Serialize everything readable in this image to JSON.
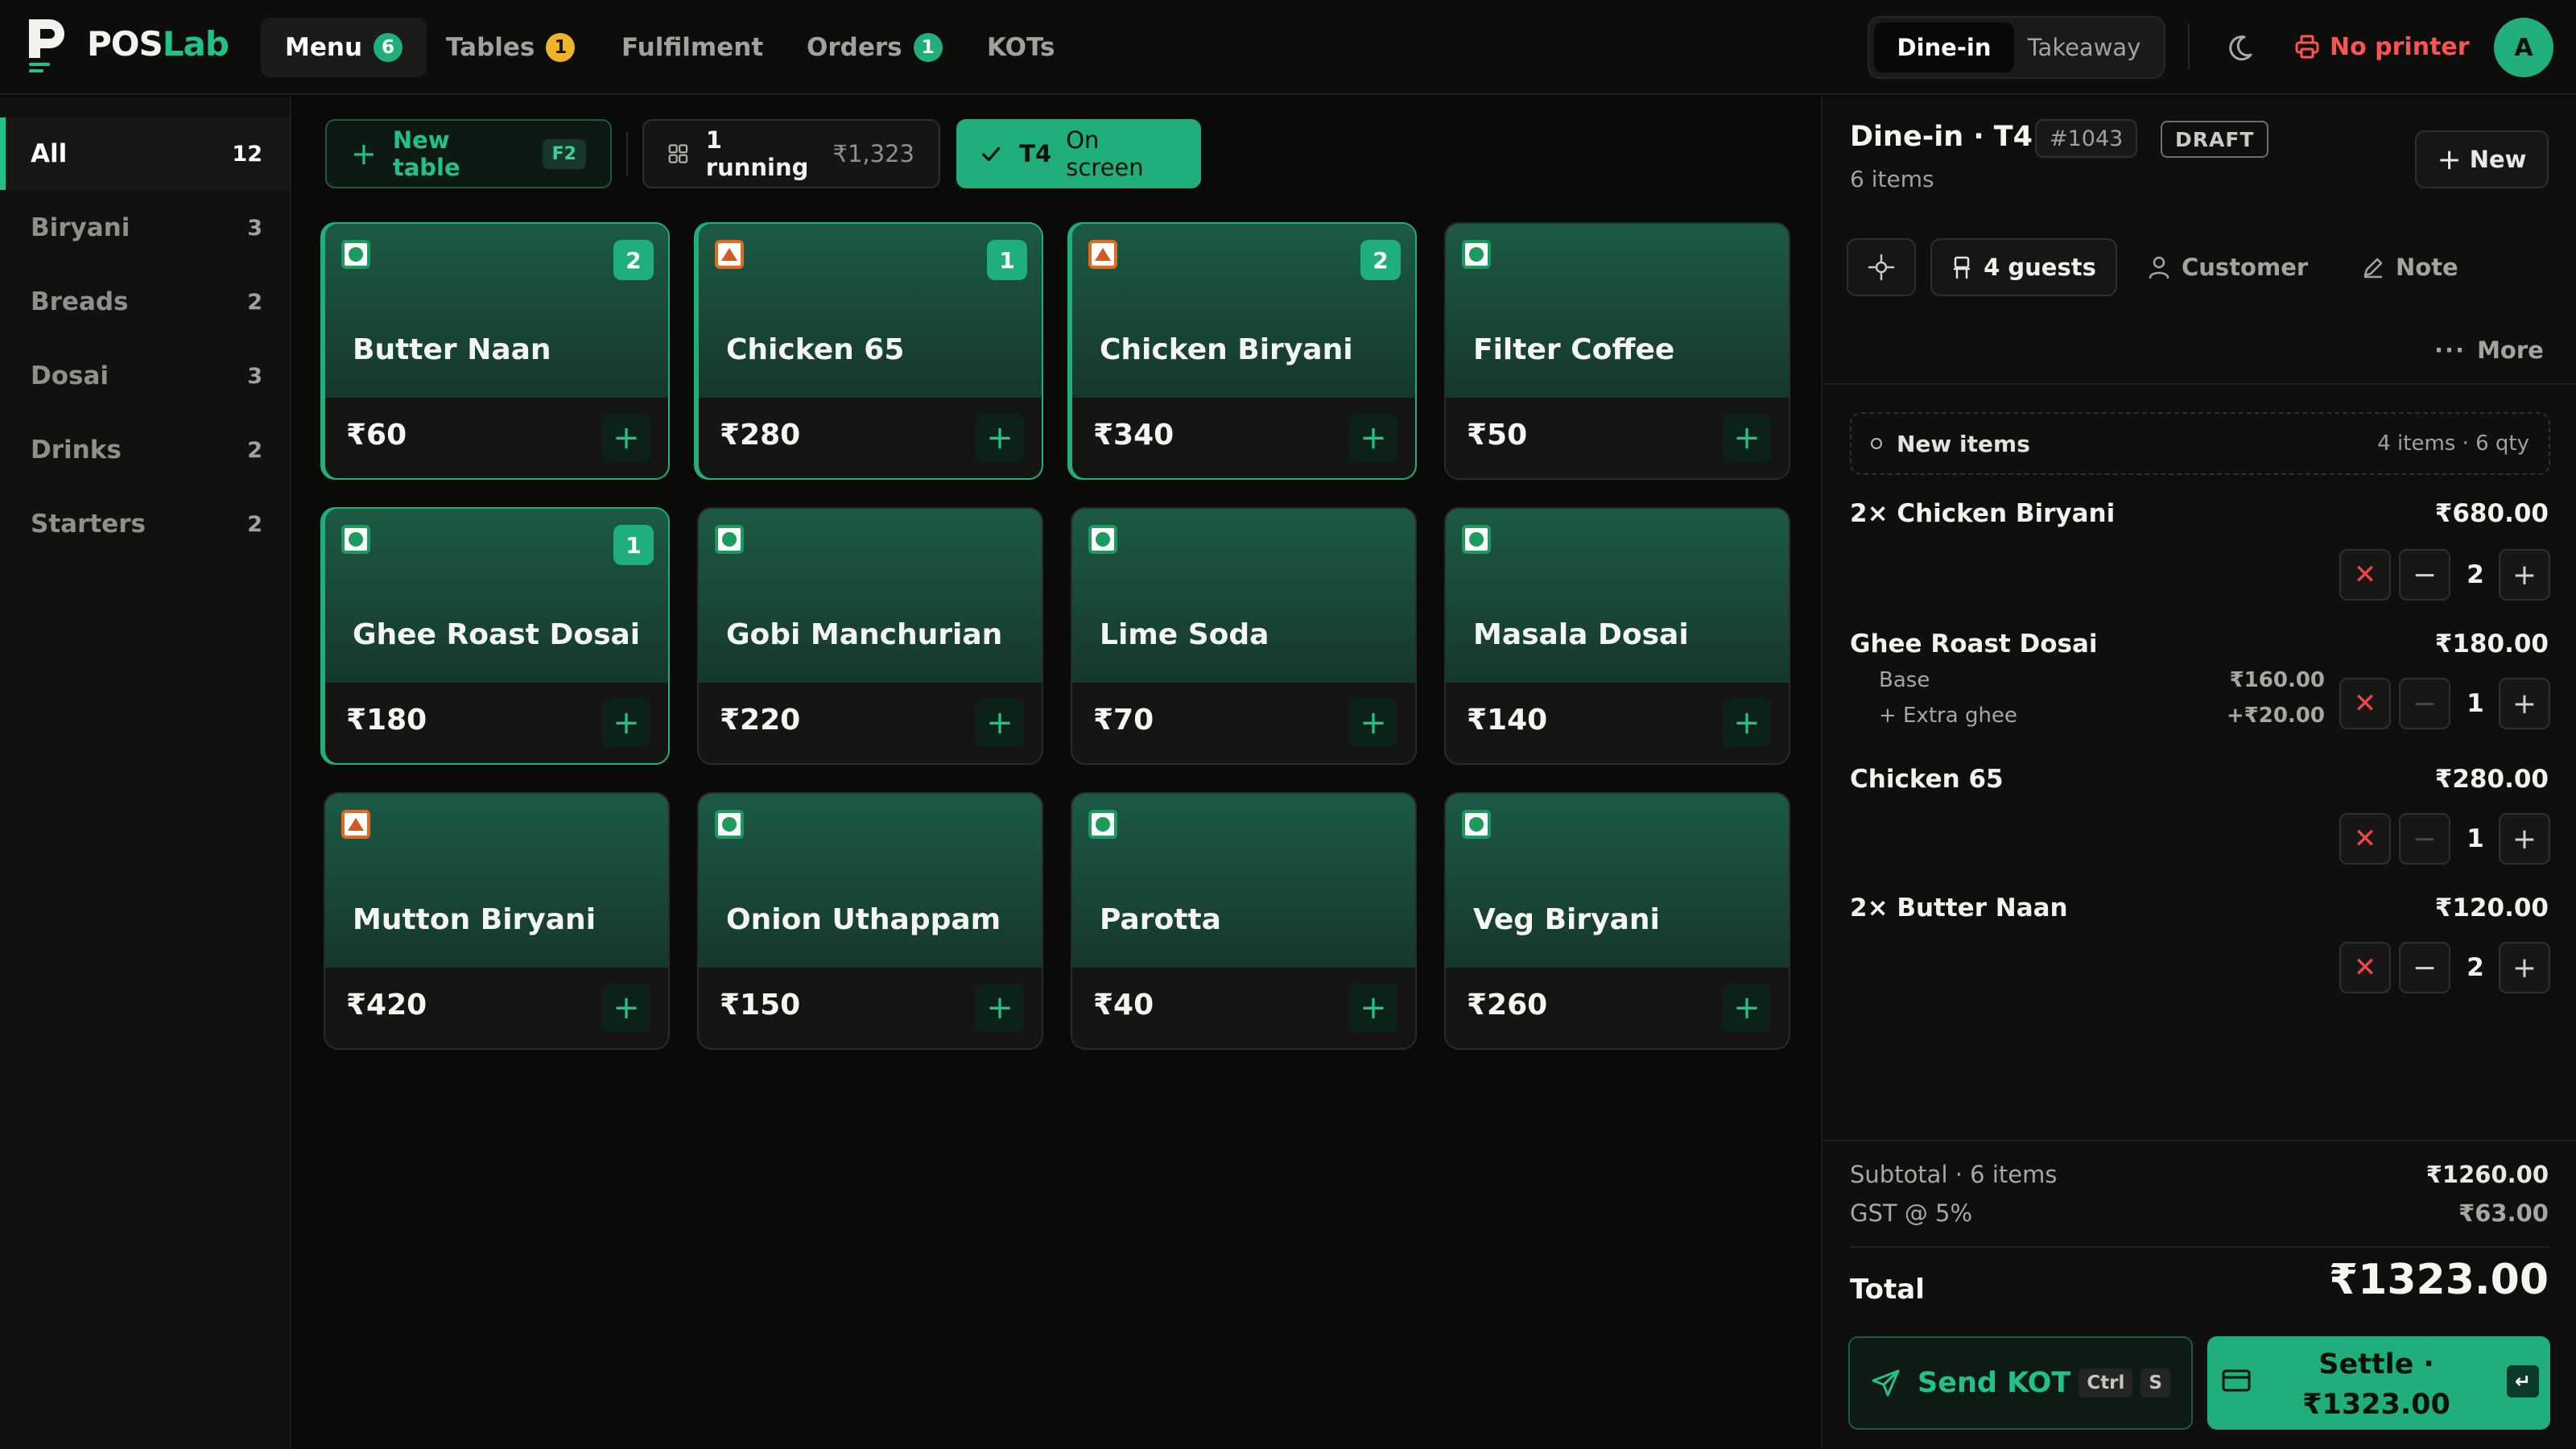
{
  "app": {
    "brand_pos": "POS",
    "brand_lab": "Lab",
    "accent_color": "#1fae7c"
  },
  "nav": {
    "tabs": [
      {
        "label": "Menu",
        "badge": "6",
        "badge_color": "green",
        "active": true
      },
      {
        "label": "Tables",
        "badge": "1",
        "badge_color": "amber"
      },
      {
        "label": "Fulfilment"
      },
      {
        "label": "Orders",
        "badge": "1",
        "badge_color": "green"
      },
      {
        "label": "KOTs"
      }
    ]
  },
  "mode": {
    "dine_in": "Dine-in",
    "takeaway": "Takeaway",
    "selected": "Dine-in"
  },
  "printer_status": "No printer",
  "avatar_initial": "A",
  "categories": [
    {
      "label": "All",
      "count": "12",
      "active": true
    },
    {
      "label": "Biryani",
      "count": "3"
    },
    {
      "label": "Breads",
      "count": "2"
    },
    {
      "label": "Dosai",
      "count": "3"
    },
    {
      "label": "Drinks",
      "count": "2"
    },
    {
      "label": "Starters",
      "count": "2"
    }
  ],
  "toolbar": {
    "new_table": "New table",
    "new_table_kbd": "F2",
    "running": "1 running",
    "running_amount": "₹1,323",
    "table": "T4",
    "table_status": "On screen"
  },
  "menu_items": [
    {
      "name": "Butter Naan",
      "price": "₹60",
      "diet": "veg",
      "qty": "2"
    },
    {
      "name": "Chicken 65",
      "price": "₹280",
      "diet": "nonveg",
      "qty": "1"
    },
    {
      "name": "Chicken Biryani",
      "price": "₹340",
      "diet": "nonveg",
      "qty": "2"
    },
    {
      "name": "Filter Coffee",
      "price": "₹50",
      "diet": "veg",
      "qty": ""
    },
    {
      "name": "Ghee Roast Dosai",
      "price": "₹180",
      "diet": "veg",
      "qty": "1"
    },
    {
      "name": "Gobi Manchurian",
      "price": "₹220",
      "diet": "veg",
      "qty": ""
    },
    {
      "name": "Lime Soda",
      "price": "₹70",
      "diet": "veg",
      "qty": ""
    },
    {
      "name": "Masala Dosai",
      "price": "₹140",
      "diet": "veg",
      "qty": ""
    },
    {
      "name": "Mutton Biryani",
      "price": "₹420",
      "diet": "nonveg",
      "qty": ""
    },
    {
      "name": "Onion Uthappam",
      "price": "₹150",
      "diet": "veg",
      "qty": ""
    },
    {
      "name": "Parotta",
      "price": "₹40",
      "diet": "veg",
      "qty": ""
    },
    {
      "name": "Veg Biryani",
      "price": "₹260",
      "diet": "veg",
      "qty": ""
    }
  ],
  "order": {
    "title": "Dine-in · T4",
    "order_no": "#1043",
    "status": "DRAFT",
    "subtitle": "6 items",
    "new_button": "New",
    "guests": "4 guests",
    "customer": "Customer",
    "note": "Note",
    "more": "More",
    "new_items_label": "New items",
    "new_items_summary": "4 items · 6 qty",
    "lines": [
      {
        "name": "2× Chicken Biryani",
        "total": "₹680.00",
        "qty": "2"
      },
      {
        "name": "Ghee Roast Dosai",
        "total": "₹180.00",
        "qty": "1",
        "modifiers": [
          {
            "label": "Base",
            "price": "₹160.00"
          },
          {
            "label": "+ Extra ghee",
            "price": "+₹20.00"
          }
        ]
      },
      {
        "name": "Chicken 65",
        "total": "₹280.00",
        "qty": "1"
      },
      {
        "name": "2× Butter Naan",
        "total": "₹120.00",
        "qty": "2"
      }
    ],
    "subtotal_label": "Subtotal · 6 items",
    "subtotal": "₹1260.00",
    "gst_label": "GST @ 5%",
    "gst": "₹63.00",
    "total_label": "Total",
    "total": "₹1323.00",
    "send_kot": "Send KOT",
    "kbd_ctrl": "Ctrl",
    "kbd_s": "S",
    "settle_line1": "Settle ·",
    "settle_line2": "₹1323.00",
    "enter_key": "↵"
  }
}
